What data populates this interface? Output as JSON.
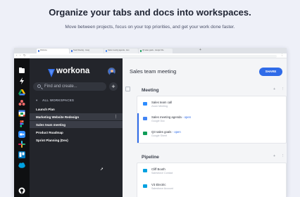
{
  "hero": {
    "title": "Organize your tabs and docs into workspaces.",
    "subtitle": "Move between projects, focus on your top priorities, and get your work done faster."
  },
  "browser_tabs": [
    {
      "label": "Workona",
      "color": "#3b6fd8"
    },
    {
      "label": "Team Meeting - Goog",
      "color": "#2f6be8"
    },
    {
      "label": "Sales meeting agenda - Goo",
      "color": "#4285f4"
    },
    {
      "label": "Q3 sales goals - Google She",
      "color": "#0f9d58"
    }
  ],
  "rail_icons": [
    {
      "name": "workspaces-icon",
      "color": "#ffffff"
    },
    {
      "name": "bolt-icon",
      "color": "#ffffff"
    },
    {
      "name": "google-drive-icon",
      "color": "#fbbc04"
    },
    {
      "name": "asana-icon",
      "color": "#f06a6a"
    },
    {
      "name": "google-calendar-icon",
      "color": "#4285f4"
    },
    {
      "name": "figma-icon",
      "color": "#a259ff"
    },
    {
      "name": "zoom-icon",
      "color": "#2d8cff"
    },
    {
      "name": "slack-icon",
      "color": "#e01e5a"
    },
    {
      "name": "trello-icon",
      "color": "#0079bf"
    },
    {
      "name": "salesforce-icon",
      "color": "#00a1e0"
    },
    {
      "name": "github-icon",
      "color": "#ffffff"
    }
  ],
  "sidebar": {
    "app_name": "workona",
    "search_placeholder": "Find and create...",
    "section_label": "ALL WORKSPACES",
    "workspaces": [
      {
        "label": "Launch Plan",
        "state": "normal"
      },
      {
        "label": "Marketing Website Redesign",
        "state": "hover"
      },
      {
        "label": "Sales team meeting",
        "state": "active"
      },
      {
        "label": "Product Roadmap",
        "state": "normal"
      },
      {
        "label": "Sprint Planning (Dev)",
        "state": "normal"
      }
    ]
  },
  "main": {
    "title": "Sales team meeting",
    "share_label": "SHARE",
    "groups": [
      {
        "label": "Meeting",
        "resources": [
          {
            "title": "Sales team call",
            "open": "",
            "subtitle": "Zoom Meeting",
            "color": "#2d8cff"
          },
          {
            "title": "Sales meeting agenda",
            "open": " - open",
            "subtitle": "Google Doc",
            "color": "#4285f4"
          },
          {
            "title": "Q3 sales goals",
            "open": " - open",
            "subtitle": "Google Sheet",
            "color": "#0f9d58"
          }
        ]
      },
      {
        "label": "Pipeline",
        "resources": [
          {
            "title": "Cliff Booth",
            "open": "",
            "subtitle": "Salesforce Contact",
            "color": "#00a1e0"
          },
          {
            "title": "V3 Electric",
            "open": "",
            "subtitle": "Salesforce Account",
            "color": "#00a1e0"
          }
        ]
      }
    ]
  }
}
